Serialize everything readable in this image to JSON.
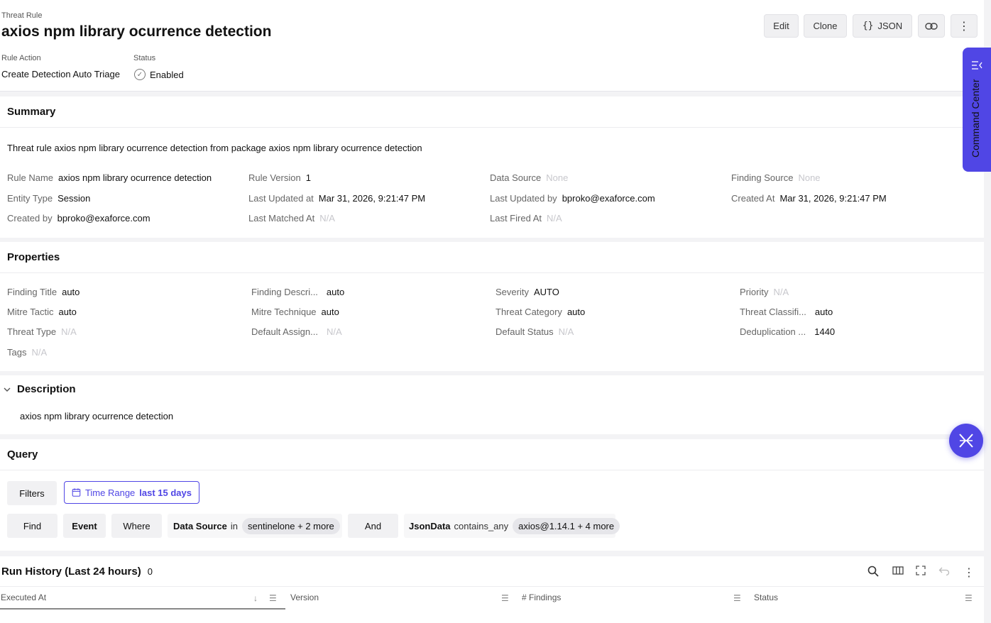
{
  "header": {
    "breadcrumb": "Threat Rule",
    "title": "axios npm library ocurrence detection",
    "rule_action_label": "Rule Action",
    "rule_action_value": "Create Detection Auto Triage",
    "status_label": "Status",
    "status_value": "Enabled",
    "buttons": {
      "edit": "Edit",
      "clone": "Clone",
      "json": "JSON"
    }
  },
  "command_center": {
    "label": "Command Center"
  },
  "summary": {
    "heading": "Summary",
    "description": "Threat rule axios npm library ocurrence detection from package axios npm library ocurrence detection",
    "fields": [
      {
        "k": "Rule Name",
        "v": "axios npm library ocurrence detection"
      },
      {
        "k": "Rule Version",
        "v": "1"
      },
      {
        "k": "Data Source",
        "v": "None"
      },
      {
        "k": "Finding Source",
        "v": "None"
      },
      {
        "k": "Entity Type",
        "v": "Session"
      },
      {
        "k": "Last Updated at",
        "v": "Mar 31, 2026, 9:21:47 PM"
      },
      {
        "k": "Last Updated by",
        "v": "bproko@exaforce.com"
      },
      {
        "k": "Created At",
        "v": "Mar 31, 2026, 9:21:47 PM"
      },
      {
        "k": "Created by",
        "v": "bproko@exaforce.com"
      },
      {
        "k": "Last Matched At",
        "v": "N/A"
      },
      {
        "k": "Last Fired At",
        "v": "N/A"
      }
    ]
  },
  "properties": {
    "heading": "Properties",
    "fields": [
      {
        "k": "Finding Title",
        "v": "auto"
      },
      {
        "k": "Finding Descri...",
        "v": "auto"
      },
      {
        "k": "Severity",
        "v": "AUTO"
      },
      {
        "k": "Priority",
        "v": "N/A"
      },
      {
        "k": "Mitre Tactic",
        "v": "auto"
      },
      {
        "k": "Mitre Technique",
        "v": "auto"
      },
      {
        "k": "Threat Category",
        "v": "auto"
      },
      {
        "k": "Threat Classifi...",
        "v": "auto"
      },
      {
        "k": "Threat Type",
        "v": "N/A"
      },
      {
        "k": "Default Assign...",
        "v": "N/A"
      },
      {
        "k": "Default Status",
        "v": "N/A"
      },
      {
        "k": "Deduplication ...",
        "v": "1440"
      },
      {
        "k": "Tags",
        "v": "N/A"
      }
    ]
  },
  "description": {
    "heading": "Description",
    "text": "axios npm library ocurrence detection"
  },
  "query": {
    "heading": "Query",
    "filters_label": "Filters",
    "time_range_label": "Time Range",
    "time_range_value": "last 15 days",
    "find": "Find",
    "event": "Event",
    "where": "Where",
    "cond1_field": "Data Source",
    "cond1_op": "in",
    "cond1_value": "sentinelone + 2 more",
    "and": "And",
    "cond2_field": "JsonData",
    "cond2_op": "contains_any",
    "cond2_value": "axios@1.14.1 + 4 more"
  },
  "run_history": {
    "heading": "Run History (Last 24 hours)",
    "count": "0",
    "columns": [
      "Executed At",
      "Version",
      "# Findings",
      "Status"
    ]
  },
  "colors": {
    "accent": "#5046e5"
  }
}
